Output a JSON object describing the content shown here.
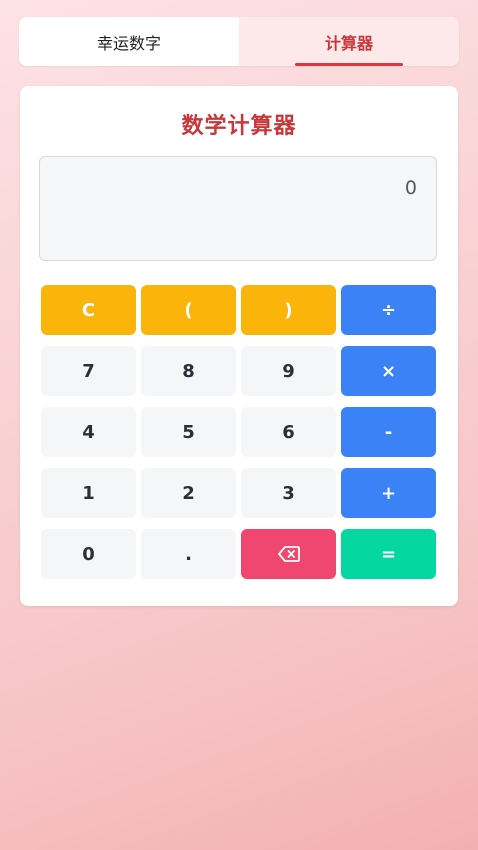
{
  "tabs": [
    {
      "label": "幸运数字",
      "active": false
    },
    {
      "label": "计算器",
      "active": true
    }
  ],
  "calculator": {
    "title": "数学计算器",
    "display_value": "0",
    "keys": {
      "clear": "C",
      "lparen": "(",
      "rparen": ")",
      "divide": "÷",
      "seven": "7",
      "eight": "8",
      "nine": "9",
      "multiply": "×",
      "four": "4",
      "five": "5",
      "six": "6",
      "subtract": "-",
      "one": "1",
      "two": "2",
      "three": "3",
      "add": "+",
      "zero": "0",
      "decimal": ".",
      "equals": "="
    }
  },
  "icons": {
    "backspace": "backspace-icon"
  },
  "colors": {
    "accent_red": "#c8373a",
    "function_key": "#fbb40a",
    "operator_key": "#3b82f6",
    "backspace_key": "#ef476f",
    "equals_key": "#06d6a0",
    "number_key": "#f5f6f8"
  }
}
